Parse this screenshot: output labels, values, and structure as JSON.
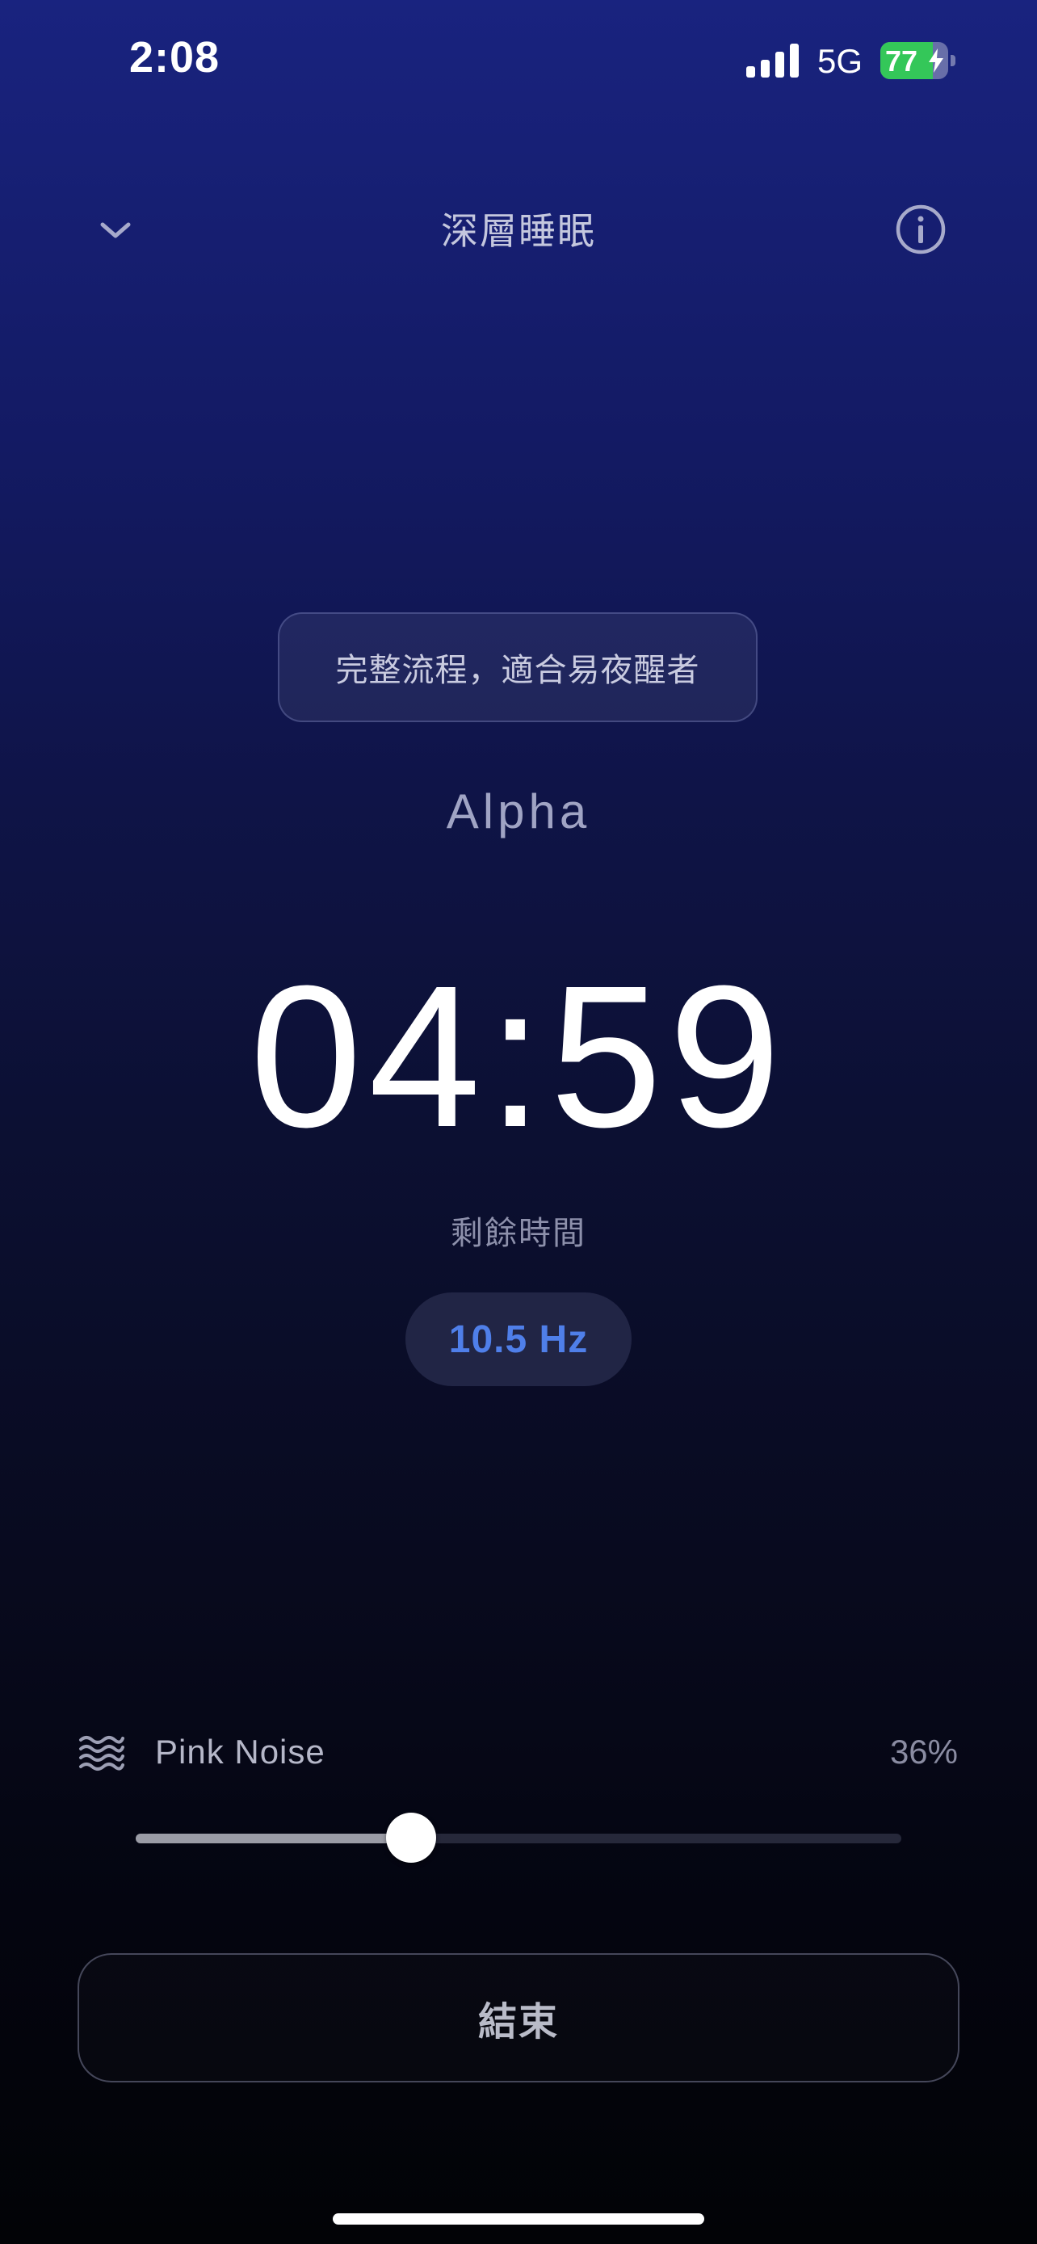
{
  "status_bar": {
    "time": "2:08",
    "network": "5G",
    "battery_percent": "77",
    "battery_level": 0.77,
    "battery_color": "#34c759",
    "signal_icon": "signal-bars-icon",
    "charging_icon": "bolt-icon"
  },
  "header": {
    "title": "深層睡眠",
    "collapse_icon": "chevron-down-icon",
    "info_icon": "info-circle-icon"
  },
  "session": {
    "description": "完整流程，適合易夜醒者",
    "wave_name": "Alpha",
    "countdown_minutes": "04",
    "countdown_separator": ":",
    "countdown_seconds": "59",
    "remaining_label": "剩餘時間",
    "frequency": "10.5 Hz",
    "frequency_color": "#4f7fe9"
  },
  "noise": {
    "icon": "waves-icon",
    "label": "Pink Noise",
    "percent_label": "36%",
    "volume": 0.36
  },
  "actions": {
    "end_label": "結束"
  }
}
